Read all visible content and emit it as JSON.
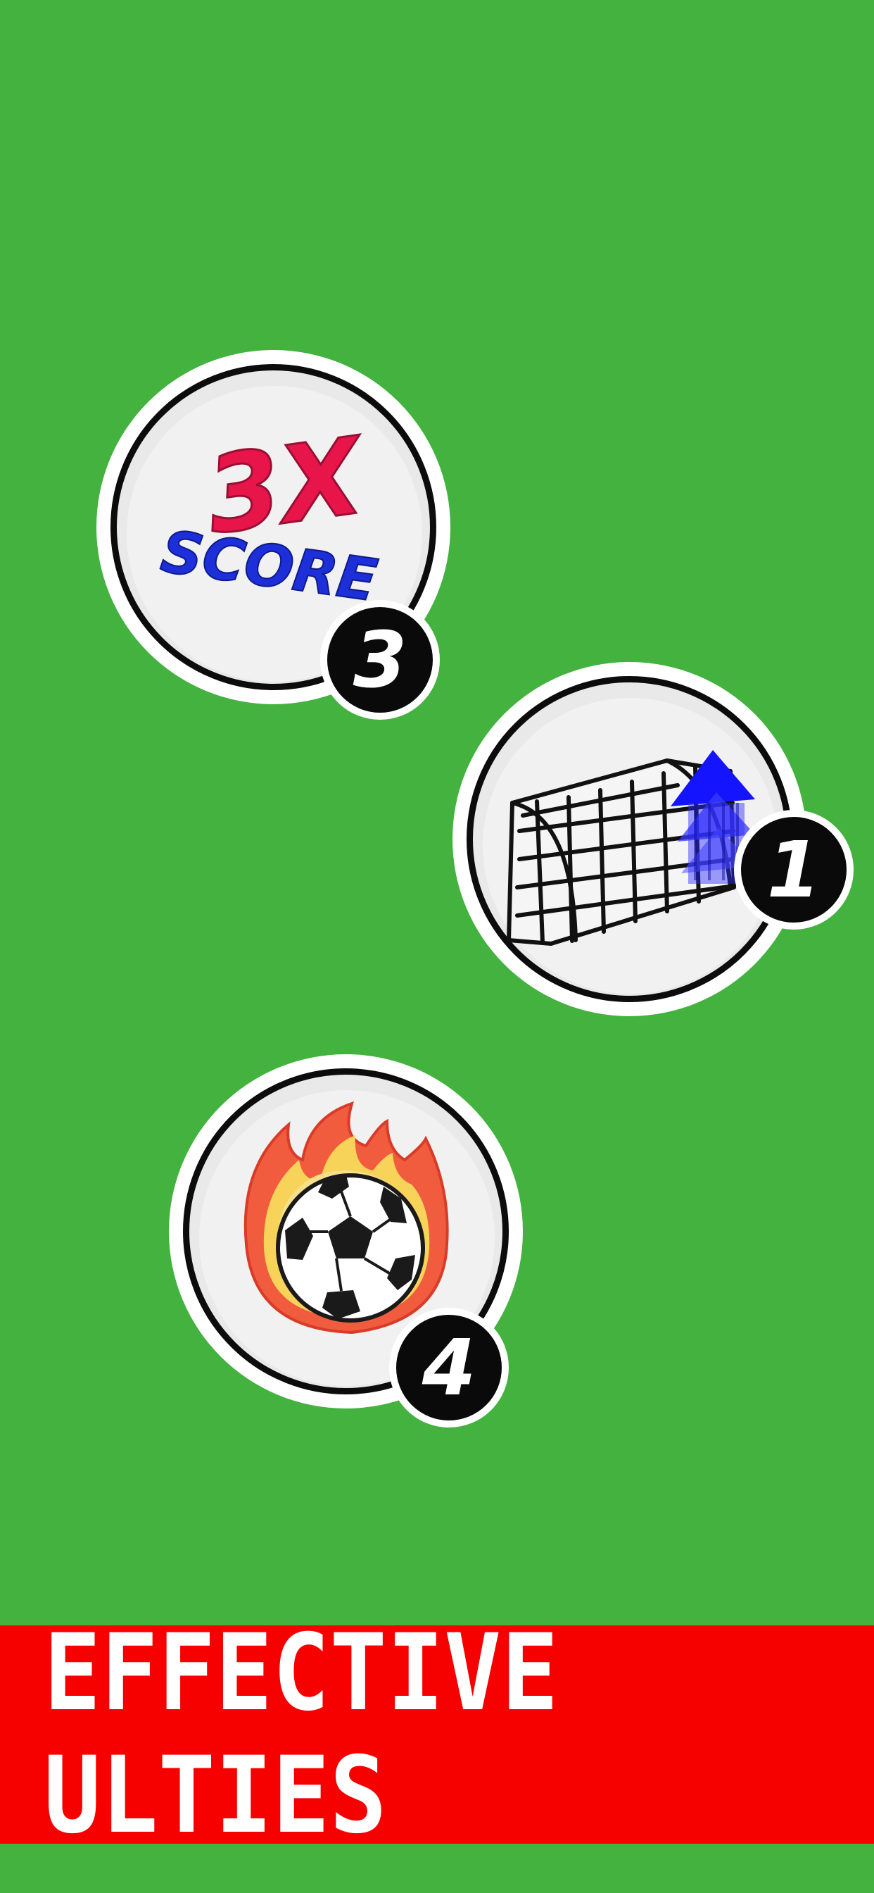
{
  "screen": {
    "background_color": "#43b23f",
    "banner_color": "#f60000"
  },
  "ultis": [
    {
      "name": "triple-score",
      "icon": "3x-score-icon",
      "title": "3X",
      "subtitle": "SCORE",
      "badge": "3"
    },
    {
      "name": "goal-boost",
      "icon": "goal-net-arrow-icon",
      "badge": "1"
    },
    {
      "name": "fire-ball",
      "icon": "flaming-ball-icon",
      "badge": "4"
    }
  ],
  "banner": {
    "label": "EFFECTIVE ULTIES"
  }
}
